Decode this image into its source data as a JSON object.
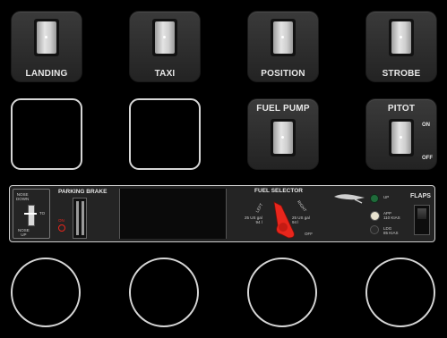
{
  "switches": {
    "landing": "LANDING",
    "taxi": "TAXI",
    "position": "POSITION",
    "strobe": "STROBE",
    "fuel_pump": "FUEL PUMP",
    "pitot": "PITOT",
    "pitot_on": "ON",
    "pitot_off": "OFF"
  },
  "panel": {
    "trim_nose_down": "NOSE\nDOWN",
    "trim_nose_up": "NOSE\nUP",
    "trim_to": "TO",
    "parking_brake": "PARKING BRAKE",
    "parking_brake_on": "ON",
    "fuel_selector": "FUEL SELECTOR",
    "fuel_left": "LEFT",
    "fuel_right": "RIGHT",
    "fuel_left_qty": "25 US gal\n94 l",
    "fuel_right_qty": "25 US gal\n94 l",
    "fuel_off": "OFF",
    "flaps_up": "UP",
    "flaps_app": "APP\n110 KIAS",
    "flaps_ldg": "LDG\n85 KIAS",
    "flaps": "FLAPS"
  },
  "colors": {
    "fuel_knob": "#e8261c",
    "flap_up_light": "#1f6b3a",
    "flap_app_light": "#e8e2cf"
  }
}
